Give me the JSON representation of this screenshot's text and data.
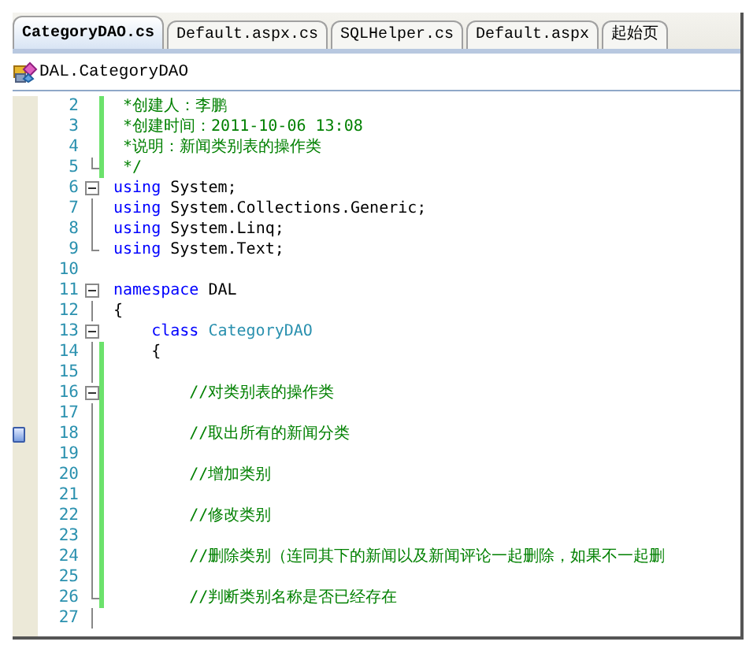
{
  "tabs": [
    {
      "label": "CategoryDAO.cs",
      "selected": true
    },
    {
      "label": "Default.aspx.cs",
      "selected": false
    },
    {
      "label": "SQLHelper.cs",
      "selected": false
    },
    {
      "label": "Default.aspx",
      "selected": false
    },
    {
      "label": "起始页",
      "selected": false
    }
  ],
  "navigation": {
    "class_selector": "DAL.CategoryDAO"
  },
  "lines": [
    {
      "number": "2",
      "kind": "plain",
      "changed": true,
      "bookmark": false,
      "tokens": [
        {
          "kind": "comment",
          "text": " *创建人：李鹏"
        }
      ]
    },
    {
      "number": "3",
      "kind": "plain",
      "changed": true,
      "bookmark": false,
      "tokens": [
        {
          "kind": "comment",
          "text": " *创建时间：2011-10-06 13:08"
        }
      ]
    },
    {
      "number": "4",
      "kind": "plain",
      "changed": true,
      "bookmark": false,
      "tokens": [
        {
          "kind": "comment",
          "text": " *说明：新闻类别表的操作类"
        }
      ]
    },
    {
      "number": "5",
      "kind": "fold-end",
      "changed": true,
      "bookmark": false,
      "tokens": [
        {
          "kind": "comment",
          "text": " */"
        }
      ]
    },
    {
      "number": "6",
      "kind": "fold-start",
      "changed": false,
      "bookmark": false,
      "tokens": [
        {
          "kind": "keyword",
          "text": "using"
        },
        {
          "kind": "plain",
          "text": " System;"
        }
      ]
    },
    {
      "number": "7",
      "kind": "fold-inner",
      "changed": false,
      "bookmark": false,
      "tokens": [
        {
          "kind": "keyword",
          "text": "using"
        },
        {
          "kind": "plain",
          "text": " System.Collections.Generic;"
        }
      ]
    },
    {
      "number": "8",
      "kind": "fold-inner",
      "changed": false,
      "bookmark": false,
      "tokens": [
        {
          "kind": "keyword",
          "text": "using"
        },
        {
          "kind": "plain",
          "text": " System.Linq;"
        }
      ]
    },
    {
      "number": "9",
      "kind": "fold-end",
      "changed": false,
      "bookmark": false,
      "tokens": [
        {
          "kind": "keyword",
          "text": "using"
        },
        {
          "kind": "plain",
          "text": " System.Text;"
        }
      ]
    },
    {
      "number": "10",
      "kind": "plain",
      "changed": false,
      "bookmark": false
    },
    {
      "number": "11",
      "kind": "fold-start",
      "changed": false,
      "bookmark": false,
      "tokens": [
        {
          "kind": "keyword",
          "text": "namespace"
        },
        {
          "kind": "plain",
          "text": " DAL"
        }
      ]
    },
    {
      "number": "12",
      "kind": "fold-inner",
      "changed": false,
      "bookmark": false,
      "tokens": [
        {
          "kind": "plain",
          "text": "{"
        }
      ]
    },
    {
      "number": "13",
      "kind": "fold-start",
      "changed": false,
      "bookmark": false,
      "tokens": [
        {
          "kind": "keyword",
          "text": "    class"
        },
        {
          "kind": "type",
          "text": " CategoryDAO"
        }
      ]
    },
    {
      "number": "14",
      "kind": "fold-inner",
      "changed": true,
      "bookmark": false,
      "tokens": [
        {
          "kind": "plain",
          "text": "    {"
        }
      ]
    },
    {
      "number": "15",
      "kind": "fold-inner",
      "changed": true,
      "bookmark": false
    },
    {
      "number": "16",
      "kind": "fold-start",
      "changed": true,
      "bookmark": false,
      "tokens": [
        {
          "kind": "comment",
          "text": "        //对类别表的操作类"
        }
      ]
    },
    {
      "number": "17",
      "kind": "fold-inner",
      "changed": true,
      "bookmark": false
    },
    {
      "number": "18",
      "kind": "fold-inner",
      "changed": true,
      "bookmark": true,
      "tokens": [
        {
          "kind": "comment",
          "text": "        //取出所有的新闻分类"
        }
      ]
    },
    {
      "number": "19",
      "kind": "fold-inner",
      "changed": true,
      "bookmark": false
    },
    {
      "number": "20",
      "kind": "fold-inner",
      "changed": true,
      "bookmark": false,
      "tokens": [
        {
          "kind": "comment",
          "text": "        //增加类别"
        }
      ]
    },
    {
      "number": "21",
      "kind": "fold-inner",
      "changed": true,
      "bookmark": false
    },
    {
      "number": "22",
      "kind": "fold-inner",
      "changed": true,
      "bookmark": false,
      "tokens": [
        {
          "kind": "comment",
          "text": "        //修改类别"
        }
      ]
    },
    {
      "number": "23",
      "kind": "fold-inner",
      "changed": true,
      "bookmark": false
    },
    {
      "number": "24",
      "kind": "fold-inner",
      "changed": true,
      "bookmark": false,
      "tokens": [
        {
          "kind": "comment",
          "text": "        //删除类别（连同其下的新闻以及新闻评论一起删除，如果不一起删"
        }
      ]
    },
    {
      "number": "25",
      "kind": "fold-inner",
      "changed": true,
      "bookmark": false
    },
    {
      "number": "26",
      "kind": "fold-end",
      "changed": true,
      "bookmark": false,
      "tokens": [
        {
          "kind": "comment",
          "text": "        //判断类别名称是否已经存在"
        }
      ]
    },
    {
      "number": "27",
      "kind": "fold-inner",
      "changed": false,
      "bookmark": false
    }
  ]
}
